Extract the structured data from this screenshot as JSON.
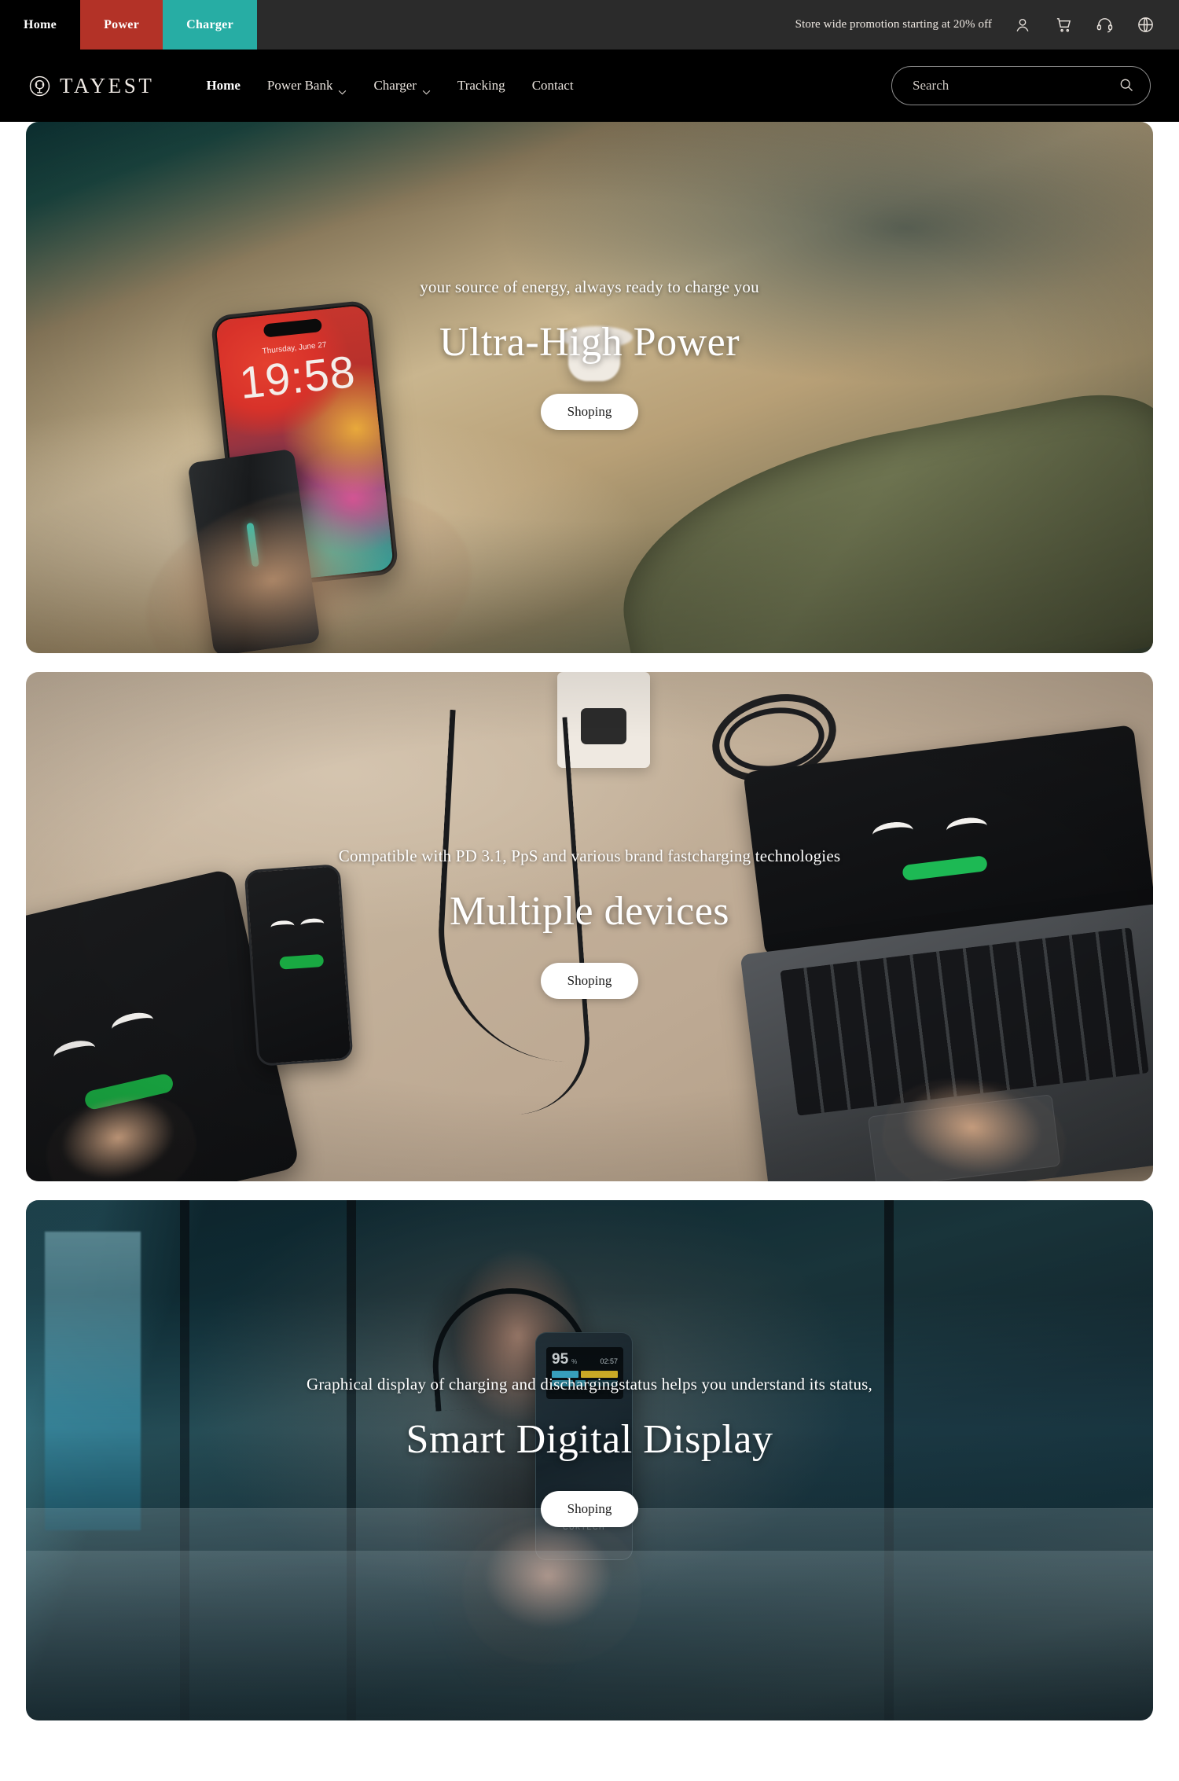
{
  "topbar": {
    "tabs": [
      {
        "label": "Home",
        "variant": "home"
      },
      {
        "label": "Power",
        "variant": "power"
      },
      {
        "label": "Charger",
        "variant": "charger"
      }
    ],
    "promo": "Store wide promotion starting at 20% off",
    "icons": [
      "user-icon",
      "cart-icon",
      "support-headset-icon",
      "globe-icon"
    ],
    "colors": {
      "bar_bg": "#2b2b2b",
      "home_bg": "#000000",
      "power_bg": "#b33227",
      "charger_bg": "#27ada4"
    }
  },
  "nav": {
    "brand": "TAYEST",
    "brand_icon": "wireless-signal-logo-icon",
    "menu": [
      {
        "label": "Home",
        "has_dropdown": false,
        "active": true
      },
      {
        "label": "Power Bank",
        "has_dropdown": true,
        "active": false
      },
      {
        "label": "Charger",
        "has_dropdown": true,
        "active": false
      },
      {
        "label": "Tracking",
        "has_dropdown": false,
        "active": false
      },
      {
        "label": "Contact",
        "has_dropdown": false,
        "active": false
      }
    ],
    "search": {
      "placeholder": "Search",
      "value": "",
      "icon": "search-icon"
    },
    "bg": "#000000"
  },
  "heroes": [
    {
      "subtitle": "your source of energy, always ready to charge you",
      "title": "Ultra-High Power",
      "cta": "Shoping",
      "phone_date": "Thursday, June 27",
      "phone_time": "19:58"
    },
    {
      "subtitle": "Compatible with PD 3.1, PpS and various brand fastcharging technologies",
      "title": "Multiple devices",
      "cta": "Shoping"
    },
    {
      "subtitle": "Graphical display of charging and dischargingstatus helps you understand its status,",
      "title": "Smart Digital Display",
      "cta": "Shoping",
      "device_percent": "95",
      "device_percent_mark": "%",
      "device_time": "02:57",
      "device_brand": "CUKTECH"
    }
  ]
}
